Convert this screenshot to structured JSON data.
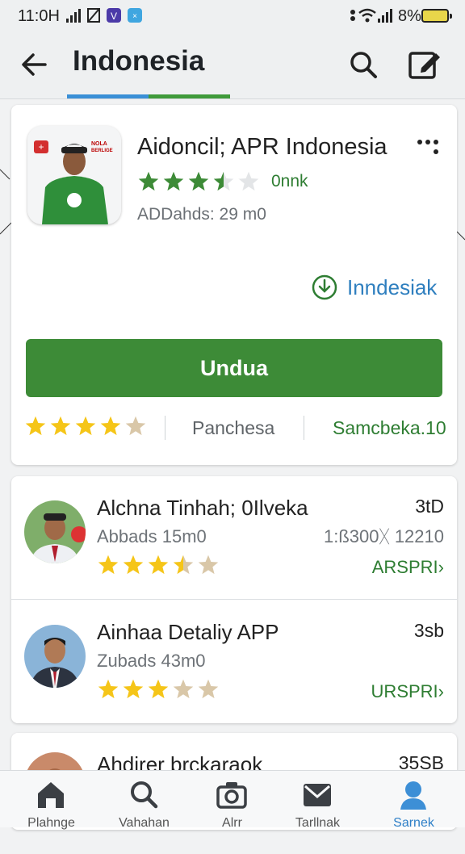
{
  "status_bar": {
    "time": "11:0H",
    "battery_percent": "8%"
  },
  "app_bar": {
    "title": "Indonesia",
    "accent_blue": "#3a8fd6",
    "accent_green": "#3f9a3a"
  },
  "featured": {
    "app_name": "Aidoncil; APR Indonesia",
    "rating": 3.5,
    "rating_count": "0nnk",
    "subtitle": "ADDahds: 29 m0",
    "download_link": "Inndesiak",
    "install_label": "Undua",
    "footer_rating": 4,
    "footer_label": "Panchesa",
    "footer_link": "Samcbeka.10",
    "icon_badge": "NOLA BERLIGE",
    "brand_green": "#3d8b37"
  },
  "list": [
    {
      "name": "Alchna Tinhah; 0Ilveka",
      "size": "Abbads 15m0",
      "rating": 3.5,
      "right": "3tD",
      "meta": "1:ß300ᚷ 12210",
      "action": "ARSPRI"
    },
    {
      "name": "Ainhaa Detaliy APP",
      "size": "Zubads 43m0",
      "rating": 3,
      "right": "3sb",
      "meta": "",
      "action": "URSPRI"
    },
    {
      "name": "Ahdirer brckaraok",
      "size": "",
      "rating": 0,
      "right": "35SB",
      "meta": "",
      "action": ""
    }
  ],
  "bottom_nav": [
    {
      "label": "Plahnge",
      "icon": "home-icon"
    },
    {
      "label": "Vahahan",
      "icon": "search-icon"
    },
    {
      "label": "Alrr",
      "icon": "camera-icon"
    },
    {
      "label": "Tarllnak",
      "icon": "mail-icon"
    },
    {
      "label": "Sarnek",
      "icon": "profile-icon",
      "active": true
    }
  ],
  "colors": {
    "star_gold": "#f5c518",
    "star_empty": "#d9c7a8",
    "link_blue": "#2f7fbf",
    "link_green": "#2e7d32",
    "nav_active": "#2f80c8"
  }
}
